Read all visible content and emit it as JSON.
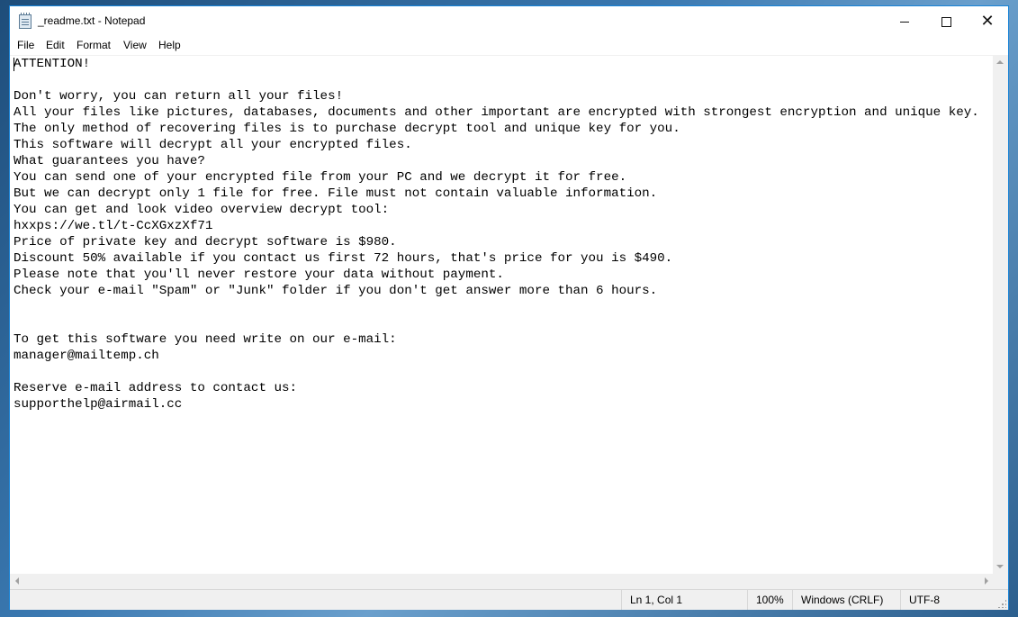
{
  "window": {
    "title": "_readme.txt - Notepad",
    "accent_color": "#1883d7"
  },
  "icons": {
    "app": "notepad-icon",
    "minimize": "minimize-icon",
    "maximize": "maximize-icon",
    "close": "close-icon"
  },
  "menu": {
    "file": "File",
    "edit": "Edit",
    "format": "Format",
    "view": "View",
    "help": "Help"
  },
  "document": {
    "text": "ATTENTION!\n\nDon't worry, you can return all your files!\nAll your files like pictures, databases, documents and other important are encrypted with strongest encryption and unique key.\nThe only method of recovering files is to purchase decrypt tool and unique key for you.\nThis software will decrypt all your encrypted files.\nWhat guarantees you have?\nYou can send one of your encrypted file from your PC and we decrypt it for free.\nBut we can decrypt only 1 file for free. File must not contain valuable information.\nYou can get and look video overview decrypt tool:\nhxxps://we.tl/t-CcXGxzXf71\nPrice of private key and decrypt software is $980.\nDiscount 50% available if you contact us first 72 hours, that's price for you is $490.\nPlease note that you'll never restore your data without payment.\nCheck your e-mail \"Spam\" or \"Junk\" folder if you don't get answer more than 6 hours.\n\n\nTo get this software you need write on our e-mail:\nmanager@mailtemp.ch\n\nReserve e-mail address to contact us:\nsupporthelp@airmail.cc"
  },
  "status": {
    "position": "Ln 1, Col 1",
    "zoom": "100%",
    "line_ending": "Windows (CRLF)",
    "encoding": "UTF-8"
  }
}
